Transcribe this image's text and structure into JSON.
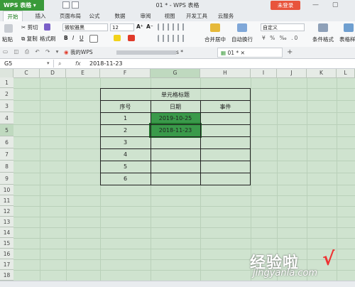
{
  "app": {
    "name": "WPS 表格",
    "window_title": "01 * - WPS 表格",
    "login_button": "未登录",
    "window_controls": "— ▢ ✕"
  },
  "menu_tabs": [
    "开始",
    "插入",
    "页面布局",
    "公式",
    "数据",
    "审阅",
    "视图",
    "开发工具",
    "云服务"
  ],
  "active_tab": "开始",
  "ribbon": {
    "cut": "剪切",
    "copy": "复制",
    "format_painter": "格式刷",
    "paste": "粘贴",
    "font_name": "微软雅黑",
    "font_size": "12",
    "bold": "B",
    "italic": "I",
    "underline": "U",
    "grow_font": "A⁺",
    "shrink_font": "A⁻",
    "merge_center": "合并居中",
    "wrap_text": "自动换行",
    "number_format": "自定义",
    "conditional_format": "条件格式",
    "table_style": "表格样式"
  },
  "doc_tabs": [
    "我的WPS",
    "s *",
    "01 *"
  ],
  "formula_bar": {
    "cell_ref": "G5",
    "fx": "fx",
    "value": "2018-11-23"
  },
  "columns": [
    "C",
    "D",
    "E",
    "F",
    "G",
    "H",
    "I",
    "J",
    "K",
    "L"
  ],
  "rows": [
    "1",
    "2",
    "3",
    "4",
    "5",
    "6",
    "7",
    "8",
    "9",
    "10",
    "11",
    "12",
    "13",
    "14",
    "15",
    "16",
    "17",
    "18"
  ],
  "table": {
    "title": "单元格标题",
    "headers": [
      "序号",
      "日期",
      "事件"
    ],
    "rows": [
      [
        "1",
        "2019-10-25",
        ""
      ],
      [
        "2",
        "2018-11-23",
        ""
      ],
      [
        "3",
        "",
        ""
      ],
      [
        "4",
        "",
        ""
      ],
      [
        "5",
        "",
        ""
      ],
      [
        "6",
        "",
        ""
      ]
    ]
  },
  "watermark": {
    "text": "经验啦",
    "check": "√",
    "url": "jingyanla.com"
  },
  "colors": {
    "accent": "#3a9a3a",
    "selection": "#3a9a4a",
    "sheet_bg": "#cfe3cf",
    "login": "#e8543c"
  }
}
